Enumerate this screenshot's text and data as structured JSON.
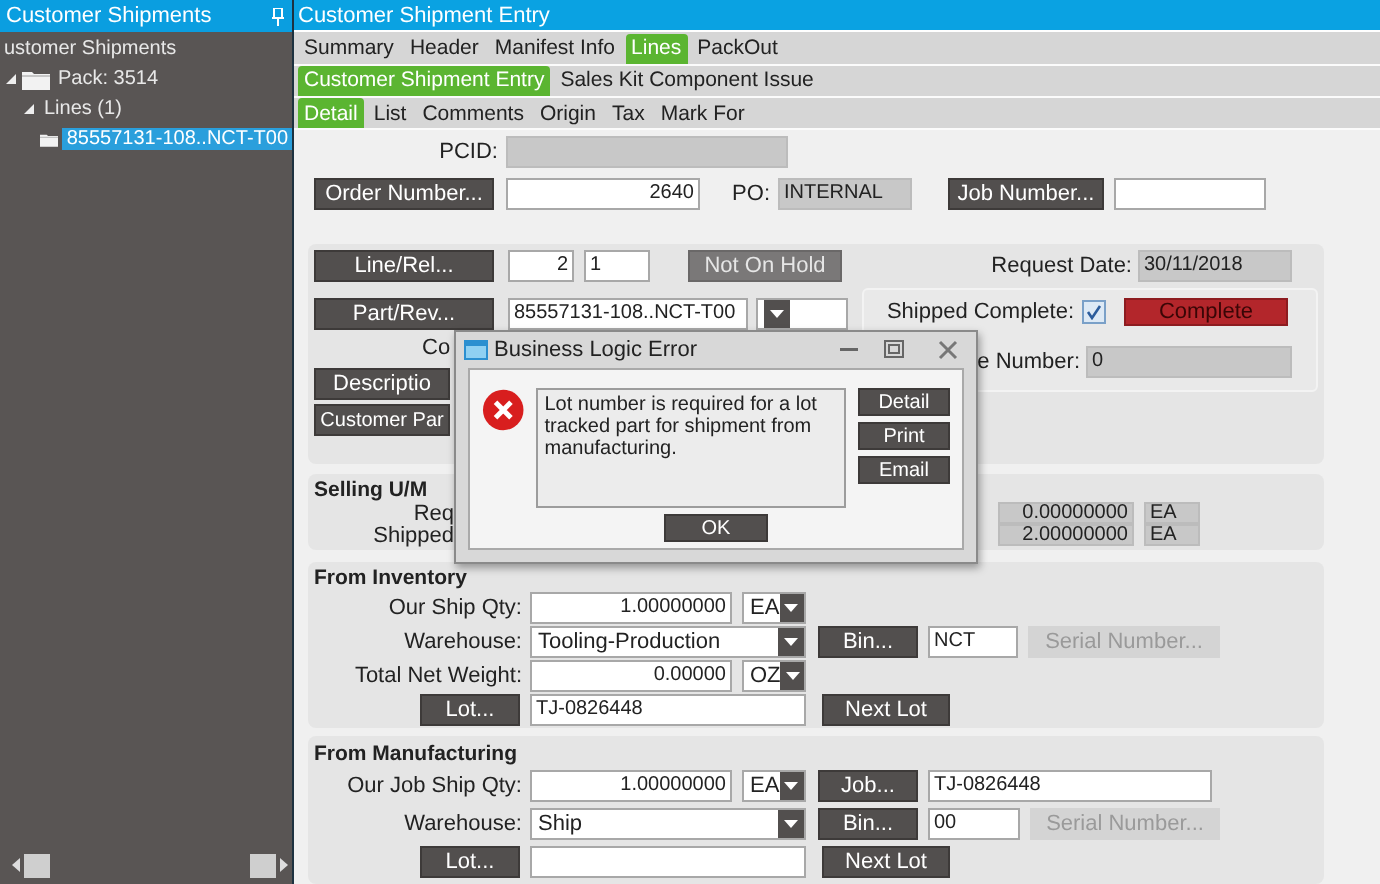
{
  "sidebar": {
    "title": "Customer Shipments",
    "tree": [
      {
        "label": "ustomer Shipments",
        "children": [
          {
            "label": "Pack: 3514",
            "kind": "folder",
            "expanded": true,
            "children": [
              {
                "label": "Lines (1)",
                "expanded": true,
                "children": [
                  {
                    "label": "85557131-108..NCT-T00",
                    "kind": "folder",
                    "selected": true
                  }
                ]
              }
            ]
          }
        ]
      }
    ]
  },
  "window": {
    "title": "Customer Shipment Entry"
  },
  "tab_rows": [
    [
      {
        "label": "Summary",
        "selected": false
      },
      {
        "label": "Header",
        "selected": false
      },
      {
        "label": "Manifest Info",
        "selected": false
      },
      {
        "label": "Lines",
        "selected": true
      },
      {
        "label": "PackOut",
        "selected": false
      }
    ],
    [
      {
        "label": "Customer Shipment Entry",
        "selected": true
      },
      {
        "label": "Sales Kit Component Issue",
        "selected": false
      }
    ],
    [
      {
        "label": "Detail",
        "selected": true
      },
      {
        "label": "List",
        "selected": false
      },
      {
        "label": "Comments",
        "selected": false
      },
      {
        "label": "Origin",
        "selected": false
      },
      {
        "label": "Tax",
        "selected": false
      },
      {
        "label": "Mark For",
        "selected": false
      }
    ]
  ],
  "header": {
    "pcid_label": "PCID:",
    "order_button": "Order Number...",
    "order_value": "2640",
    "po_label": "PO:",
    "po_value": "INTERNAL",
    "job_button": "Job Number..."
  },
  "line": {
    "line_button": "Line/Rel...",
    "line": "2",
    "release": "1",
    "hold_button": "Not On Hold",
    "part_button": "Part/Rev...",
    "part": "85557131-108..NCT-T00",
    "co_label": "Co",
    "description_button": "Descriptio",
    "customer_part_button": "Customer Par",
    "request_date_label": "Request Date:",
    "request_date": "30/11/2018",
    "shipped_complete_label": "Shipped Complete:",
    "shipped_complete": true,
    "complete_status": "Complete",
    "number_label": "e Number:",
    "number_value": "0"
  },
  "selling": {
    "title": "Selling U/M",
    "rows": [
      {
        "label": "Req",
        "value": "0.00000000",
        "unit": "EA"
      },
      {
        "label": "Shipped",
        "value": "2.00000000",
        "unit": "EA"
      }
    ]
  },
  "inventory": {
    "title": "From Inventory",
    "qty_label": "Our Ship Qty:",
    "qty": "1.00000000",
    "qty_uom": "EA",
    "warehouse_label": "Warehouse:",
    "warehouse": "Tooling-Production",
    "bin_button": "Bin...",
    "bin": "NCT",
    "serial_button": {
      "label": "Serial Number...",
      "disabled": true
    },
    "weight_label": "Total Net Weight:",
    "weight": "0.00000",
    "weight_uom": "OZ",
    "lot_button": "Lot...",
    "lot": "TJ-0826448",
    "next_lot_button": "Next Lot"
  },
  "manufacturing": {
    "title": "From Manufacturing",
    "qty_label": "Our Job Ship Qty:",
    "qty": "1.00000000",
    "qty_uom": "EA",
    "job_button": "Job...",
    "job": "TJ-0826448",
    "warehouse_label": "Warehouse:",
    "warehouse": "Ship",
    "bin_button": "Bin...",
    "bin": "00",
    "serial_button": {
      "label": "Serial Number...",
      "disabled": true
    },
    "lot_button": "Lot...",
    "next_lot_button": "Next Lot"
  },
  "dialog": {
    "title": "Business Logic Error",
    "message": "Lot number is required for a lot tracked part for shipment from manufacturing.",
    "buttons": [
      "Detail",
      "Print",
      "Email"
    ],
    "ok_button": "OK"
  }
}
